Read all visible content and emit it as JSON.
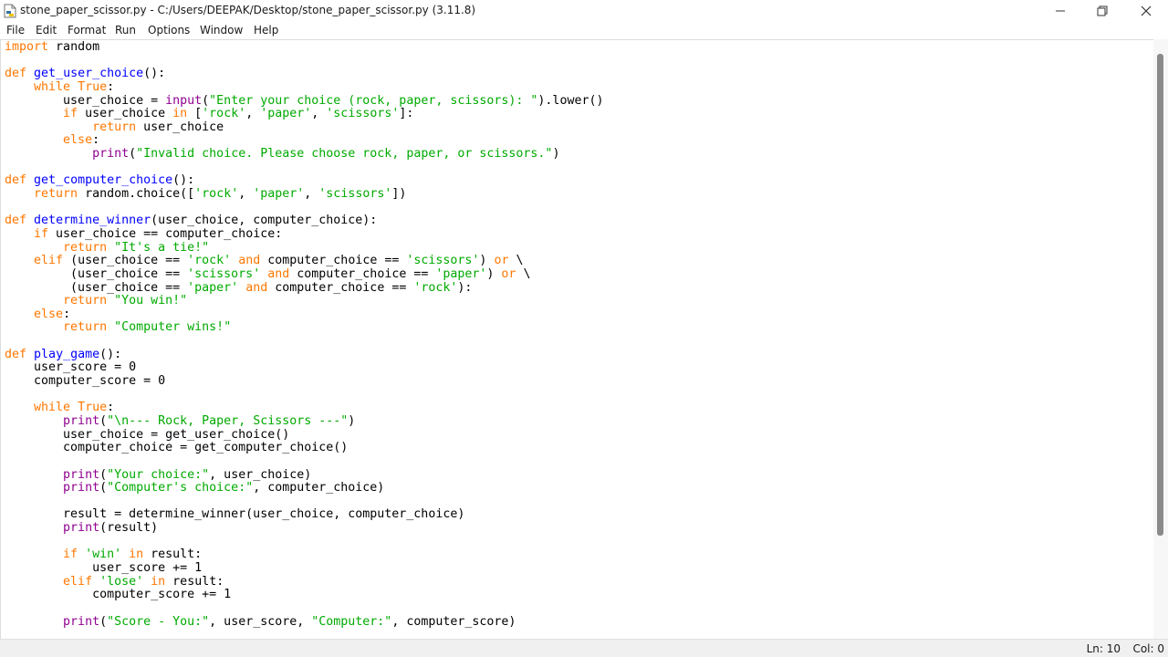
{
  "window": {
    "title": "stone_paper_scissor.py - C:/Users/DEEPAK/Desktop/stone_paper_scissor.py (3.11.8)"
  },
  "menu": [
    "File",
    "Edit",
    "Format",
    "Run",
    "Options",
    "Window",
    "Help"
  ],
  "status": {
    "line": "Ln: 10",
    "col": "Col: 0"
  },
  "colors": {
    "keyword": "#ff7700",
    "builtin": "#900090",
    "string": "#00aa00",
    "definition": "#0000ff",
    "default": "#000000"
  },
  "icons": {
    "app": "python-file-icon",
    "minimize": "minimize-icon",
    "maximize": "restore-icon",
    "close": "close-icon"
  },
  "code": [
    [
      [
        "k",
        "import"
      ],
      [
        "n",
        " random"
      ]
    ],
    [],
    [
      [
        "k",
        "def"
      ],
      [
        "n",
        " "
      ],
      [
        "d",
        "get_user_choice"
      ],
      [
        "n",
        "():"
      ]
    ],
    [
      [
        "n",
        "    "
      ],
      [
        "k",
        "while"
      ],
      [
        "n",
        " "
      ],
      [
        "k",
        "True"
      ],
      [
        "n",
        ":"
      ]
    ],
    [
      [
        "n",
        "        user_choice = "
      ],
      [
        "b",
        "input"
      ],
      [
        "n",
        "("
      ],
      [
        "s",
        "\"Enter your choice (rock, paper, scissors): \""
      ],
      [
        "n",
        ").lower()"
      ]
    ],
    [
      [
        "n",
        "        "
      ],
      [
        "k",
        "if"
      ],
      [
        "n",
        " user_choice "
      ],
      [
        "k",
        "in"
      ],
      [
        "n",
        " ["
      ],
      [
        "s",
        "'rock'"
      ],
      [
        "n",
        ", "
      ],
      [
        "s",
        "'paper'"
      ],
      [
        "n",
        ", "
      ],
      [
        "s",
        "'scissors'"
      ],
      [
        "n",
        "]:"
      ]
    ],
    [
      [
        "n",
        "            "
      ],
      [
        "k",
        "return"
      ],
      [
        "n",
        " user_choice"
      ]
    ],
    [
      [
        "n",
        "        "
      ],
      [
        "k",
        "else"
      ],
      [
        "n",
        ":"
      ]
    ],
    [
      [
        "n",
        "            "
      ],
      [
        "b",
        "print"
      ],
      [
        "n",
        "("
      ],
      [
        "s",
        "\"Invalid choice. Please choose rock, paper, or scissors.\""
      ],
      [
        "n",
        ")"
      ]
    ],
    [],
    [
      [
        "k",
        "def"
      ],
      [
        "n",
        " "
      ],
      [
        "d",
        "get_computer_choice"
      ],
      [
        "n",
        "():"
      ]
    ],
    [
      [
        "n",
        "    "
      ],
      [
        "k",
        "return"
      ],
      [
        "n",
        " random.choice(["
      ],
      [
        "s",
        "'rock'"
      ],
      [
        "n",
        ", "
      ],
      [
        "s",
        "'paper'"
      ],
      [
        "n",
        ", "
      ],
      [
        "s",
        "'scissors'"
      ],
      [
        "n",
        "])"
      ]
    ],
    [],
    [
      [
        "k",
        "def"
      ],
      [
        "n",
        " "
      ],
      [
        "d",
        "determine_winner"
      ],
      [
        "n",
        "(user_choice, computer_choice):"
      ]
    ],
    [
      [
        "n",
        "    "
      ],
      [
        "k",
        "if"
      ],
      [
        "n",
        " user_choice == computer_choice:"
      ]
    ],
    [
      [
        "n",
        "        "
      ],
      [
        "k",
        "return"
      ],
      [
        "n",
        " "
      ],
      [
        "s",
        "\"It's a tie!\""
      ]
    ],
    [
      [
        "n",
        "    "
      ],
      [
        "k",
        "elif"
      ],
      [
        "n",
        " (user_choice == "
      ],
      [
        "s",
        "'rock'"
      ],
      [
        "n",
        " "
      ],
      [
        "k",
        "and"
      ],
      [
        "n",
        " computer_choice == "
      ],
      [
        "s",
        "'scissors'"
      ],
      [
        "n",
        ") "
      ],
      [
        "k",
        "or"
      ],
      [
        "n",
        " \\"
      ]
    ],
    [
      [
        "n",
        "         (user_choice == "
      ],
      [
        "s",
        "'scissors'"
      ],
      [
        "n",
        " "
      ],
      [
        "k",
        "and"
      ],
      [
        "n",
        " computer_choice == "
      ],
      [
        "s",
        "'paper'"
      ],
      [
        "n",
        ") "
      ],
      [
        "k",
        "or"
      ],
      [
        "n",
        " \\"
      ]
    ],
    [
      [
        "n",
        "         (user_choice == "
      ],
      [
        "s",
        "'paper'"
      ],
      [
        "n",
        " "
      ],
      [
        "k",
        "and"
      ],
      [
        "n",
        " computer_choice == "
      ],
      [
        "s",
        "'rock'"
      ],
      [
        "n",
        "):"
      ]
    ],
    [
      [
        "n",
        "        "
      ],
      [
        "k",
        "return"
      ],
      [
        "n",
        " "
      ],
      [
        "s",
        "\"You win!\""
      ]
    ],
    [
      [
        "n",
        "    "
      ],
      [
        "k",
        "else"
      ],
      [
        "n",
        ":"
      ]
    ],
    [
      [
        "n",
        "        "
      ],
      [
        "k",
        "return"
      ],
      [
        "n",
        " "
      ],
      [
        "s",
        "\"Computer wins!\""
      ]
    ],
    [],
    [
      [
        "k",
        "def"
      ],
      [
        "n",
        " "
      ],
      [
        "d",
        "play_game"
      ],
      [
        "n",
        "():"
      ]
    ],
    [
      [
        "n",
        "    user_score = 0"
      ]
    ],
    [
      [
        "n",
        "    computer_score = 0"
      ]
    ],
    [],
    [
      [
        "n",
        "    "
      ],
      [
        "k",
        "while"
      ],
      [
        "n",
        " "
      ],
      [
        "k",
        "True"
      ],
      [
        "n",
        ":"
      ]
    ],
    [
      [
        "n",
        "        "
      ],
      [
        "b",
        "print"
      ],
      [
        "n",
        "("
      ],
      [
        "s",
        "\"\\n--- Rock, Paper, Scissors ---\""
      ],
      [
        "n",
        ")"
      ]
    ],
    [
      [
        "n",
        "        user_choice = get_user_choice()"
      ]
    ],
    [
      [
        "n",
        "        computer_choice = get_computer_choice()"
      ]
    ],
    [],
    [
      [
        "n",
        "        "
      ],
      [
        "b",
        "print"
      ],
      [
        "n",
        "("
      ],
      [
        "s",
        "\"Your choice:\""
      ],
      [
        "n",
        ", user_choice)"
      ]
    ],
    [
      [
        "n",
        "        "
      ],
      [
        "b",
        "print"
      ],
      [
        "n",
        "("
      ],
      [
        "s",
        "\"Computer's choice:\""
      ],
      [
        "n",
        ", computer_choice)"
      ]
    ],
    [],
    [
      [
        "n",
        "        result = determine_winner(user_choice, computer_choice)"
      ]
    ],
    [
      [
        "n",
        "        "
      ],
      [
        "b",
        "print"
      ],
      [
        "n",
        "(result)"
      ]
    ],
    [],
    [
      [
        "n",
        "        "
      ],
      [
        "k",
        "if"
      ],
      [
        "n",
        " "
      ],
      [
        "s",
        "'win'"
      ],
      [
        "n",
        " "
      ],
      [
        "k",
        "in"
      ],
      [
        "n",
        " result:"
      ]
    ],
    [
      [
        "n",
        "            user_score += 1"
      ]
    ],
    [
      [
        "n",
        "        "
      ],
      [
        "k",
        "elif"
      ],
      [
        "n",
        " "
      ],
      [
        "s",
        "'lose'"
      ],
      [
        "n",
        " "
      ],
      [
        "k",
        "in"
      ],
      [
        "n",
        " result:"
      ]
    ],
    [
      [
        "n",
        "            computer_score += 1"
      ]
    ],
    [],
    [
      [
        "n",
        "        "
      ],
      [
        "b",
        "print"
      ],
      [
        "n",
        "("
      ],
      [
        "s",
        "\"Score - You:\""
      ],
      [
        "n",
        ", user_score, "
      ],
      [
        "s",
        "\"Computer:\""
      ],
      [
        "n",
        ", computer_score)"
      ]
    ]
  ]
}
